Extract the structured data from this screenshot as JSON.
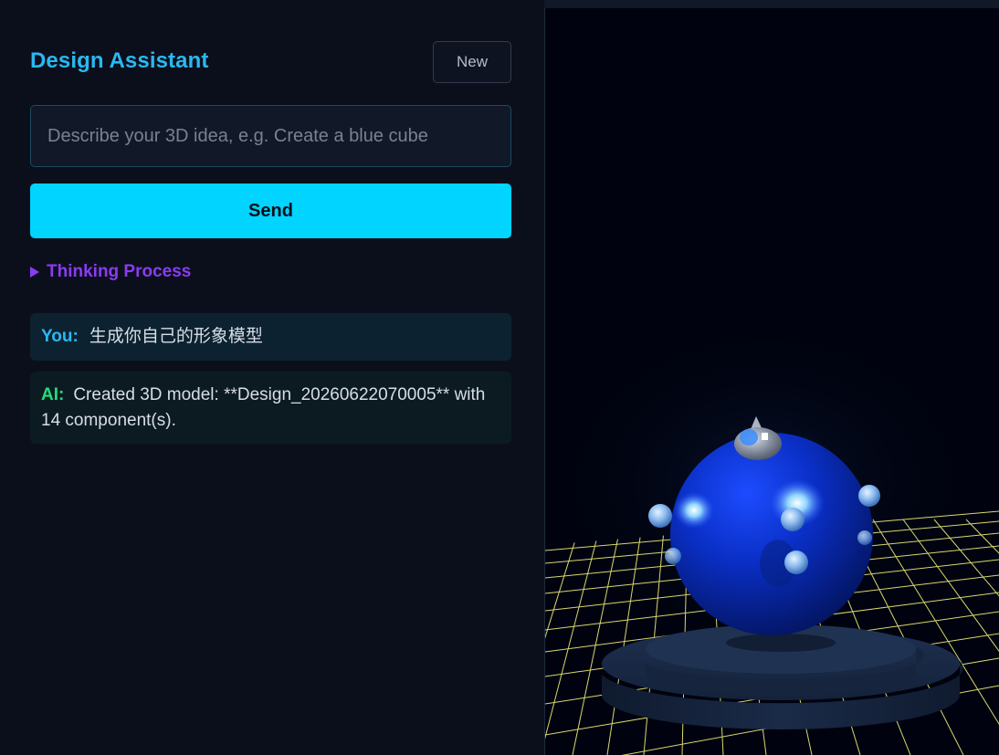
{
  "sidebar": {
    "title": "Design Assistant",
    "new_button": "New",
    "prompt_placeholder": "Describe your 3D idea, e.g. Create a blue cube",
    "prompt_value": "",
    "send_button": "Send",
    "thinking_label": "Thinking Process",
    "messages": [
      {
        "who": "You:",
        "text": "生成你自己的形象模型"
      },
      {
        "who": "AI:",
        "text": "Created 3D model: **Design_20260622070005** with 14 component(s)."
      }
    ]
  },
  "colors": {
    "accent": "#00d4ff",
    "title": "#2ab8f0",
    "thinking": "#8a3cf0",
    "ai_label": "#22dd7a",
    "grid": "#e8e87a",
    "sphere": "#0a2ec8"
  }
}
